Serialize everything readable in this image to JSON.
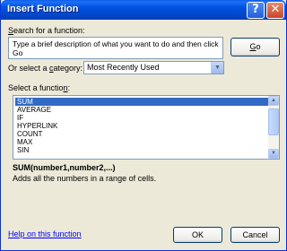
{
  "window": {
    "title": "Insert Function",
    "help_glyph": "?",
    "close_glyph": "✕"
  },
  "search": {
    "label_key": "S",
    "label_rest": "earch for a function:",
    "value": "Type a brief description of what you want to do and then click Go",
    "go_key": "G",
    "go_rest": "o"
  },
  "category": {
    "label_pre": "Or select a ",
    "label_key": "c",
    "label_rest": "ategory:",
    "selected": "Most Recently Used"
  },
  "functions": {
    "label_pre": "Select a functio",
    "label_key": "n",
    "label_rest": ":",
    "items": [
      "SUM",
      "AVERAGE",
      "IF",
      "HYPERLINK",
      "COUNT",
      "MAX",
      "SIN"
    ],
    "selected_index": 0
  },
  "details": {
    "signature": "SUM(number1,number2,...)",
    "description": "Adds all the numbers in a range of cells."
  },
  "footer": {
    "help_link": "Help on this function",
    "ok": "OK",
    "cancel": "Cancel"
  },
  "colors": {
    "title_bar": "#0054e3",
    "selection": "#316ac5",
    "link": "#0000ff"
  }
}
